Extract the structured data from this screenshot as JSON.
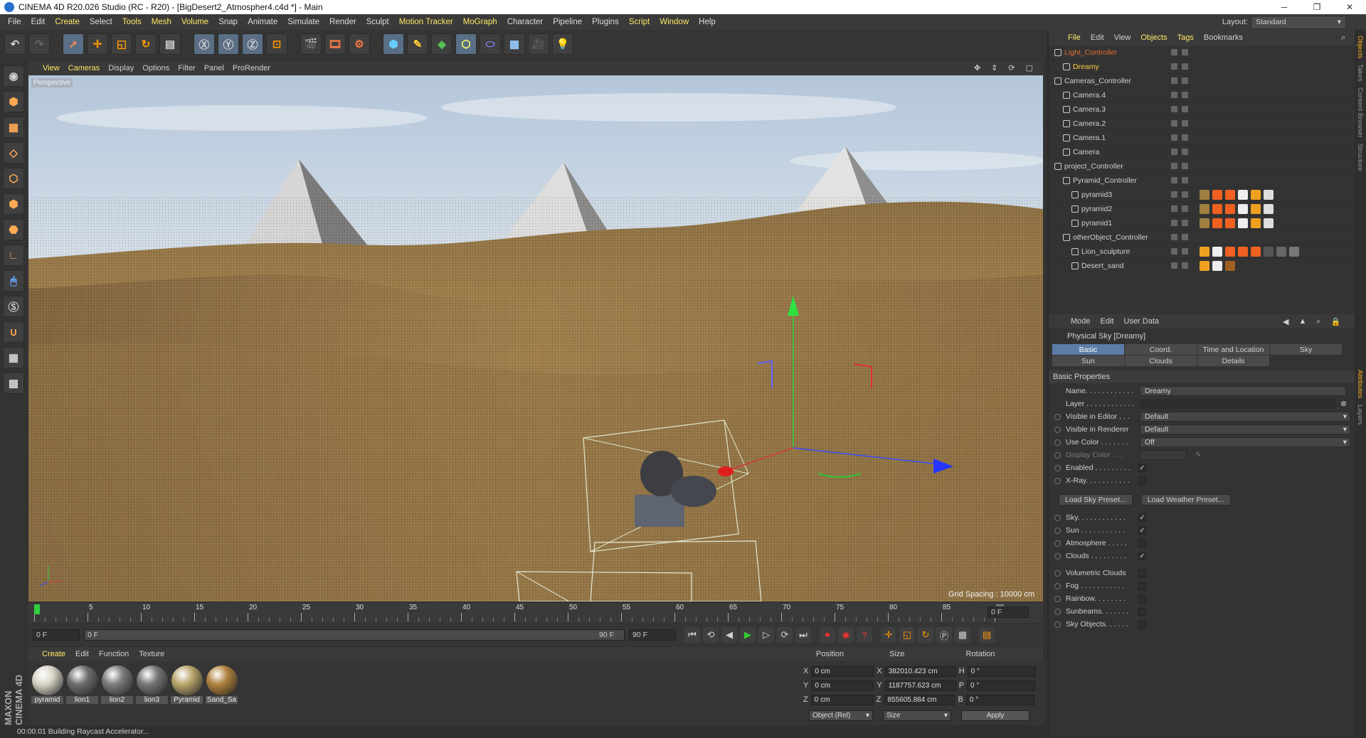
{
  "window": {
    "title": "CINEMA 4D R20.026 Studio (RC - R20) - [BigDesert2_Atmospher4.c4d *] - Main"
  },
  "menubar": {
    "items": [
      "File",
      "Edit",
      "Create",
      "Select",
      "Tools",
      "Mesh",
      "Volume",
      "Snap",
      "Animate",
      "Simulate",
      "Render",
      "Sculpt",
      "Motion Tracker",
      "MoGraph",
      "Character",
      "Pipeline",
      "Plugins",
      "Script",
      "Window",
      "Help"
    ]
  },
  "layout": {
    "label": "Layout:",
    "value": "Standard"
  },
  "viewport": {
    "menu": [
      "View",
      "Cameras",
      "Display",
      "Options",
      "Filter",
      "Panel",
      "ProRender"
    ],
    "label": "Perspective",
    "grid_spacing": "Grid Spacing : 10000 cm"
  },
  "timeline": {
    "ticks": [
      "0",
      "5",
      "10",
      "15",
      "20",
      "25",
      "30",
      "35",
      "40",
      "45",
      "50",
      "55",
      "60",
      "65",
      "70",
      "75",
      "80",
      "85",
      "90"
    ],
    "end_field": "0 F",
    "start_frame": "0 F",
    "slider_start": "0 F",
    "slider_end": "90 F",
    "end_frame": "90 F"
  },
  "materials": {
    "menu": [
      "Create",
      "Edit",
      "Function",
      "Texture"
    ],
    "items": [
      {
        "name": "pyramid",
        "color": "#d9d6c8"
      },
      {
        "name": "lion1",
        "color": "#6e6e6e"
      },
      {
        "name": "lion2",
        "color": "#7c7c7c"
      },
      {
        "name": "lion3",
        "color": "#767676"
      },
      {
        "name": "Pyramid",
        "color": "#b9a66c"
      },
      {
        "name": "Sand_Sa",
        "color": "#b0823e"
      }
    ]
  },
  "coords": {
    "headers": [
      "Position",
      "Size",
      "Rotation"
    ],
    "rows": [
      {
        "axis": "X",
        "pos": "0 cm",
        "size_axis": "X",
        "size": "382010.423 cm",
        "rot_axis": "H",
        "rot": "0 °"
      },
      {
        "axis": "Y",
        "pos": "0 cm",
        "size_axis": "Y",
        "size": "1187757.623 cm",
        "rot_axis": "P",
        "rot": "0 °"
      },
      {
        "axis": "Z",
        "pos": "0 cm",
        "size_axis": "Z",
        "size": "855605.884 cm",
        "rot_axis": "B",
        "rot": "0 °"
      }
    ],
    "mode": "Object (Rel)",
    "size_mode": "Size",
    "apply": "Apply"
  },
  "status": {
    "text": "00:00:01 Building Raycast Accelerator..."
  },
  "brand": {
    "text": "MAXON CINEMA 4D"
  },
  "object_manager": {
    "menu": [
      "File",
      "Edit",
      "View",
      "Objects",
      "Tags",
      "Bookmarks"
    ],
    "objects": [
      {
        "name": "Light_Controller",
        "depth": 0,
        "color": "#e07030"
      },
      {
        "name": "Dreamy",
        "depth": 1,
        "color": "#ffcf40"
      },
      {
        "name": "Cameras_Controller",
        "depth": 0,
        "color": "#d0d0d0"
      },
      {
        "name": "Camera.4",
        "depth": 1,
        "color": "#d0d0d0"
      },
      {
        "name": "Camera.3",
        "depth": 1,
        "color": "#d0d0d0"
      },
      {
        "name": "Camera.2",
        "depth": 1,
        "color": "#d0d0d0"
      },
      {
        "name": "Camera.1",
        "depth": 1,
        "color": "#d0d0d0"
      },
      {
        "name": "Camera",
        "depth": 1,
        "color": "#d0d0d0"
      },
      {
        "name": "project_Controller",
        "depth": 0,
        "color": "#d0d0d0"
      },
      {
        "name": "Pyramid_Controller",
        "depth": 1,
        "color": "#d0d0d0"
      },
      {
        "name": "pyramid3",
        "depth": 2,
        "color": "#d0d0d0"
      },
      {
        "name": "pyramid2",
        "depth": 2,
        "color": "#d0d0d0"
      },
      {
        "name": "pyramid1",
        "depth": 2,
        "color": "#d0d0d0"
      },
      {
        "name": "otherObject_Controller",
        "depth": 1,
        "color": "#d0d0d0"
      },
      {
        "name": "Lion_sculpture",
        "depth": 2,
        "color": "#d0d0d0"
      },
      {
        "name": "Desert_sand",
        "depth": 2,
        "color": "#d0d0d0"
      }
    ]
  },
  "attributes": {
    "menu": [
      "Mode",
      "Edit",
      "User Data"
    ],
    "title": "Physical Sky [Dreamy]",
    "tabs": [
      "Basic",
      "Coord.",
      "Time and Location",
      "Sky",
      "Sun",
      "Clouds",
      "Details"
    ],
    "section": "Basic Properties",
    "name_label": "Name. . . . . . . . . . . .",
    "name_value": "Dreamy",
    "layer_label": "Layer . . . . . . . . . . . .",
    "visible_editor_label": "Visible in Editor . . .",
    "visible_editor_value": "Default",
    "visible_renderer_label": "Visible in Renderer",
    "visible_renderer_value": "Default",
    "use_color_label": "Use Color . . . . . . .",
    "use_color_value": "Off",
    "display_color_label": "Display Color . . .",
    "enabled_label": "Enabled . . . . . . . . .",
    "xray_label": "X-Ray. . . . . . . . . . .",
    "load_sky": "Load Sky Preset...",
    "load_weather": "Load Weather Preset...",
    "checks1": [
      {
        "label": "Sky. . . . . . . . . . . .",
        "checked": "✓"
      },
      {
        "label": "Sun . . . . . . . . . . .",
        "checked": "✓"
      },
      {
        "label": "Atmosphere . . . . .",
        "checked": ""
      },
      {
        "label": "Clouds . . . . . . . . .",
        "checked": "✓"
      }
    ],
    "checks2": [
      {
        "label": "Volumetric Clouds",
        "checked": ""
      },
      {
        "label": "Fog . . . . . . . . . . .",
        "checked": ""
      },
      {
        "label": "Rainbow. . . . . . . .",
        "checked": ""
      },
      {
        "label": "Sunbeams. . . . . . .",
        "checked": ""
      },
      {
        "label": "Sky Objects. . . . . .",
        "checked": ""
      }
    ]
  },
  "sidetabs": [
    "Objects",
    "Takes",
    "Content Browser",
    "Structure",
    "Attributes",
    "Layers"
  ]
}
